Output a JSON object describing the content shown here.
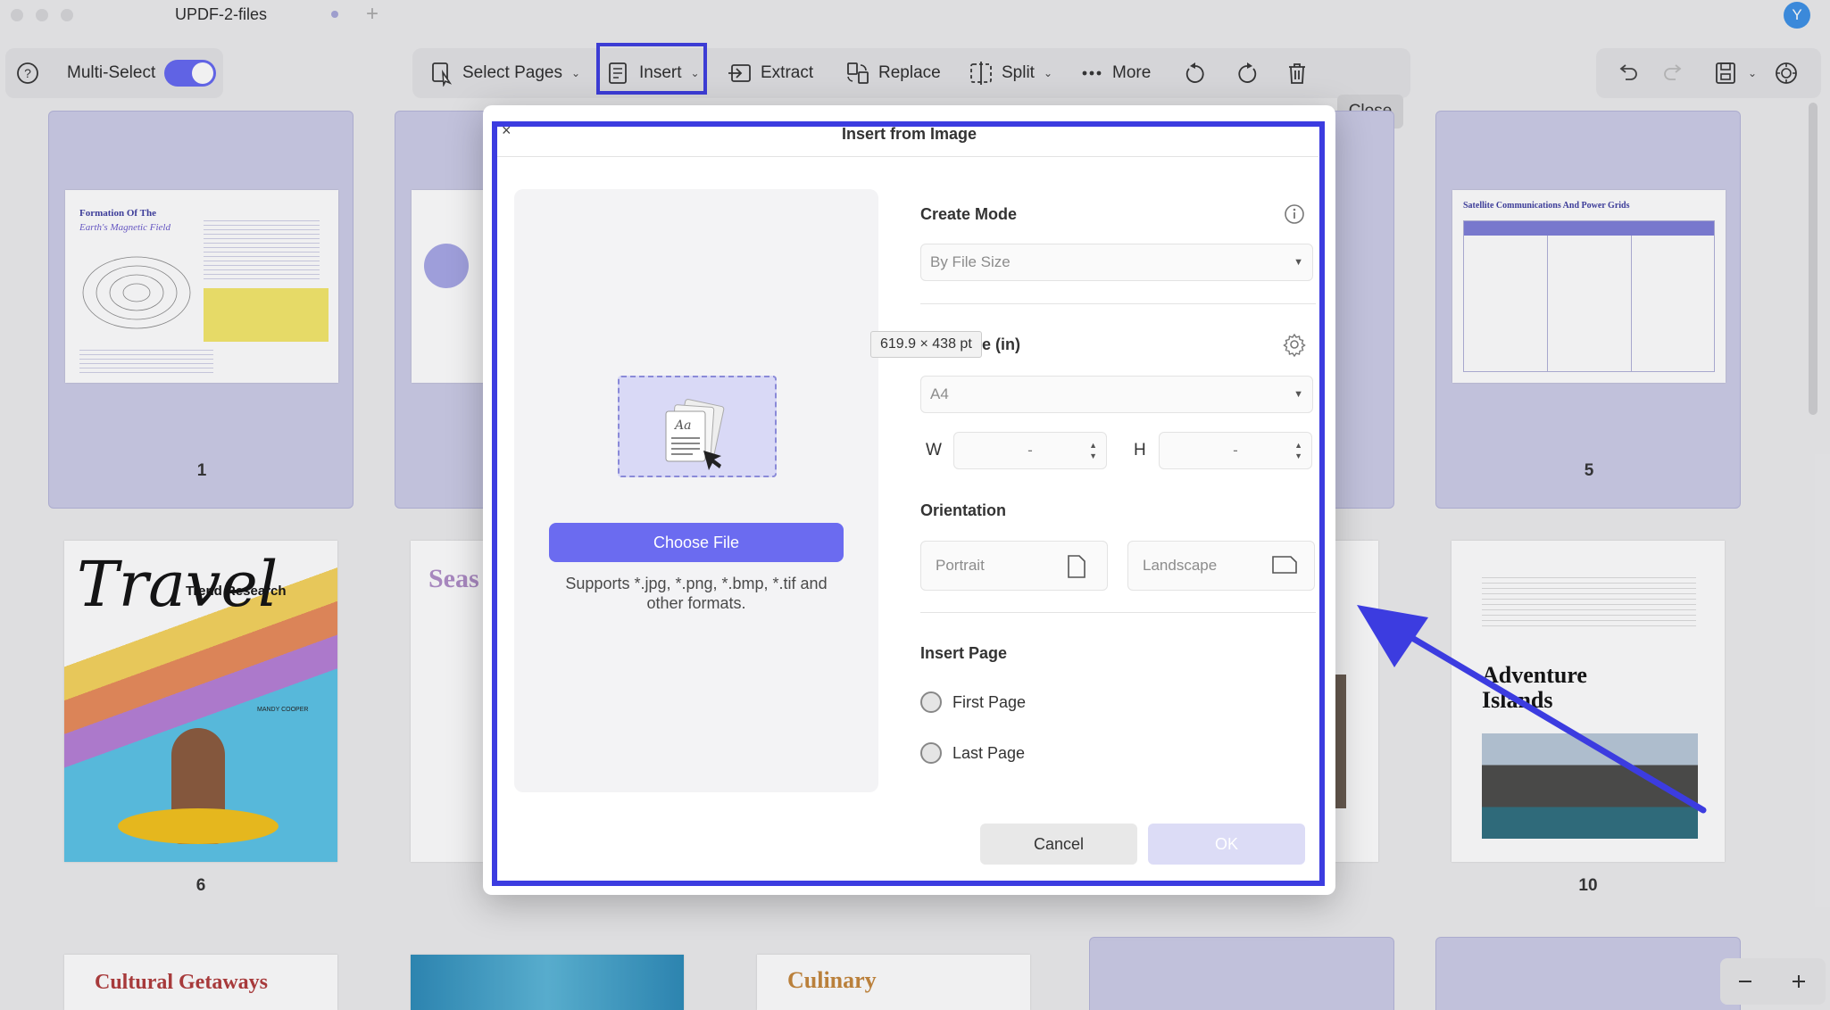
{
  "window": {
    "tab_title": "UPDF-2-files",
    "tab_plus": "+",
    "user_initial": "Y"
  },
  "toolbar": {
    "multi_select_label": "Multi-Select",
    "multi_select_on": true,
    "select_pages": "Select Pages",
    "insert": "Insert",
    "extract": "Extract",
    "replace": "Replace",
    "split": "Split",
    "more": "More",
    "close": "Close"
  },
  "pages": [
    {
      "number": "1",
      "title_line1": "Formation Of The",
      "title_line2": "Earth's Magnetic Field"
    },
    {
      "number": "5",
      "title": "Satellite Communications And Power Grids"
    },
    {
      "number": "6",
      "title": "Travel",
      "subtitle": "Trend Research",
      "author": "MANDY COOPER"
    },
    {
      "number": "10",
      "title_line1": "Adventure",
      "title_line2": "Islands"
    },
    {
      "title": "Seas"
    },
    {
      "title": "Cultural Getaways"
    },
    {
      "title": "Culinary"
    }
  ],
  "dialog": {
    "title": "Insert from Image",
    "close_glyph": "×",
    "choose_file": "Choose File",
    "supports": "Supports *.jpg, *.png, *.bmp, *.tif and other formats.",
    "create_mode_label": "Create Mode",
    "create_mode_value": "By File Size",
    "page_size_label_visible": "e (in)",
    "page_size_value": "A4",
    "w_label": "W",
    "w_value": "-",
    "h_label": "H",
    "h_value": "-",
    "orientation_label": "Orientation",
    "portrait": "Portrait",
    "landscape": "Landscape",
    "insert_page_label": "Insert Page",
    "first_page": "First Page",
    "last_page": "Last Page",
    "cancel": "Cancel",
    "ok": "OK",
    "tooltip": "619.9 × 438 pt"
  },
  "colors": {
    "accent": "#6366f1",
    "highlight": "#3c3ce0",
    "arrow": "#3c3ce0"
  }
}
